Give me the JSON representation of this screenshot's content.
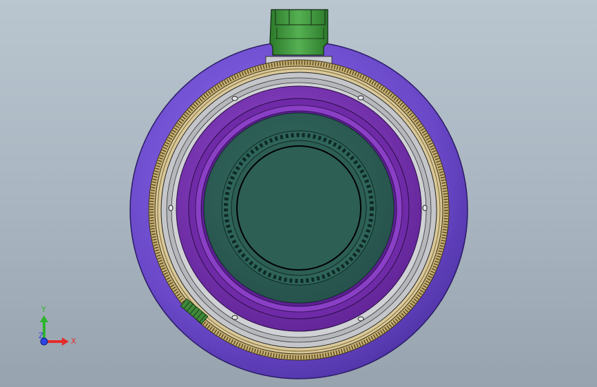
{
  "app": {
    "view": "Front",
    "display_style": "Shaded with edges"
  },
  "colors": {
    "background_top": "#b9c5cf",
    "background_bottom": "#97a3ae",
    "outer_shell": "#6a48c8",
    "inner_purple": "#7a33b8",
    "core_teal": "#2e5f55",
    "connector_green": "#3f9a3d",
    "gear_gold": "#b59a56",
    "metal_gray": "#bfc1c5",
    "axis_x": "#e52b2b",
    "axis_y": "#2cb52c",
    "axis_z": "#2c44e6"
  },
  "triad": {
    "x_label": "X",
    "y_label": "Y",
    "z_label": "Z"
  },
  "model": {
    "parts": [
      "outer-housing",
      "focus-ring",
      "bayonet-mount",
      "inner-barrel",
      "optical-core",
      "connector-block",
      "pcb-strip"
    ]
  }
}
